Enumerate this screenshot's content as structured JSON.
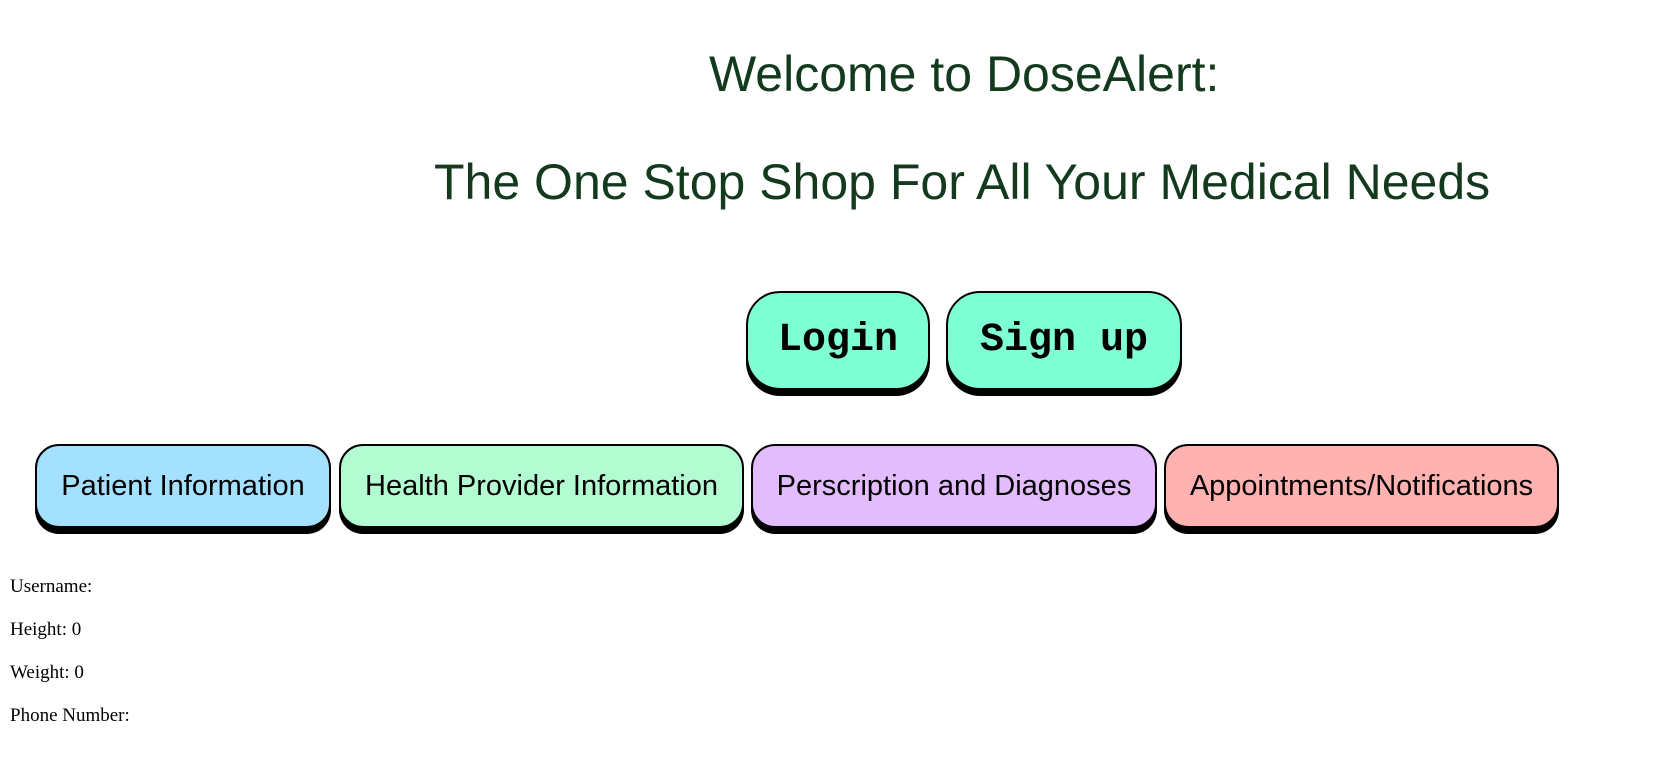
{
  "header": {
    "title": "Welcome to DoseAlert:",
    "subtitle": "The One Stop Shop For All Your Medical Needs"
  },
  "auth": {
    "login_label": "Login",
    "signup_label": "Sign up"
  },
  "tabs": [
    {
      "label": "Patient Information",
      "color": "#a4e0ff"
    },
    {
      "label": "Health Provider Information",
      "color": "#b3fbd0"
    },
    {
      "label": "Perscription and Diagnoses",
      "color": "#e2bcfc"
    },
    {
      "label": "Appointments/Notifications",
      "color": "#ffb2b0"
    }
  ],
  "patient_info": {
    "username": "Username:",
    "height": "Height: 0",
    "weight": "Weight: 0",
    "phone": "Phone Number:"
  },
  "colors": {
    "heading_text": "#143a1e",
    "auth_button": "#7fffd4"
  }
}
